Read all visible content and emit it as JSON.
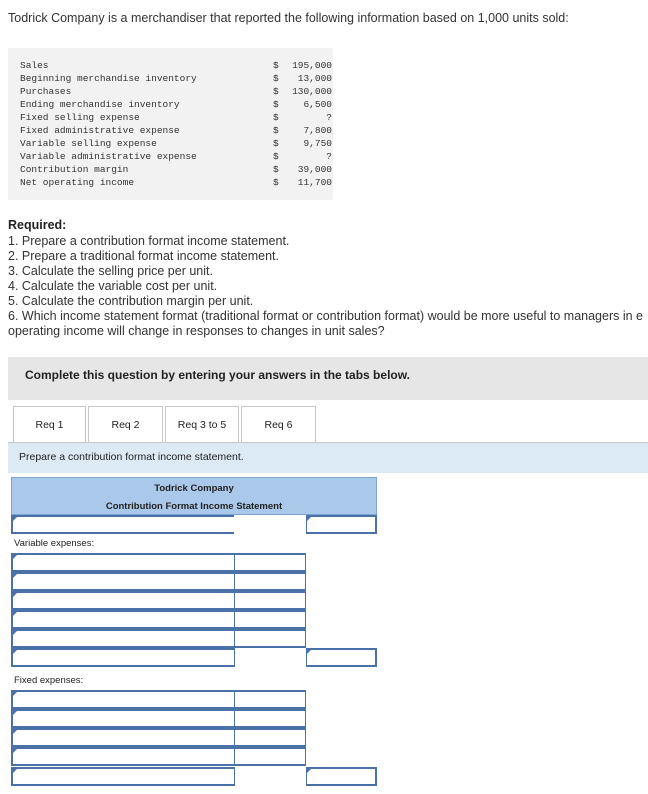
{
  "intro": "Todrick Company is a merchandiser that reported the following information based on 1,000 units sold:",
  "given": [
    {
      "label": "Sales",
      "dollar": "$",
      "value": "195,000"
    },
    {
      "label": "Beginning merchandise inventory",
      "dollar": "$",
      "value": "13,000"
    },
    {
      "label": "Purchases",
      "dollar": "$",
      "value": "130,000"
    },
    {
      "label": "Ending merchandise inventory",
      "dollar": "$",
      "value": "6,500"
    },
    {
      "label": "Fixed selling expense",
      "dollar": "$",
      "value": "?"
    },
    {
      "label": "Fixed administrative expense",
      "dollar": "$",
      "value": "7,800"
    },
    {
      "label": "Variable selling expense",
      "dollar": "$",
      "value": "9,750"
    },
    {
      "label": "Variable administrative expense",
      "dollar": "$",
      "value": "?"
    },
    {
      "label": "Contribution margin",
      "dollar": "$",
      "value": "39,000"
    },
    {
      "label": "Net operating income",
      "dollar": "$",
      "value": "11,700"
    }
  ],
  "required": {
    "title": "Required:",
    "items": [
      "1. Prepare a contribution format income statement.",
      "2. Prepare a traditional format income statement.",
      "3. Calculate the selling price per unit.",
      "4. Calculate the variable cost per unit.",
      "5. Calculate the contribution margin per unit.",
      "6. Which income statement format (traditional format or contribution format) would be more useful to managers in e",
      "operating income will change in responses to changes in unit sales?"
    ]
  },
  "banner": "Complete this question by entering your answers in the tabs below.",
  "tabs": [
    "Req 1",
    "Req 2",
    "Req 3 to 5",
    "Req 6"
  ],
  "active_tab": "Req 1",
  "prompt": "Prepare a contribution format income statement.",
  "statement": {
    "company": "Todrick Company",
    "title": "Contribution Format Income Statement",
    "variable_label": "Variable expenses:",
    "fixed_label": "Fixed expenses:"
  },
  "colors": {
    "header_blue": "#a9c8ea",
    "input_border": "#4a72a8",
    "prompt_bg": "#dceaf6",
    "banner_bg": "#e6e6e6"
  }
}
